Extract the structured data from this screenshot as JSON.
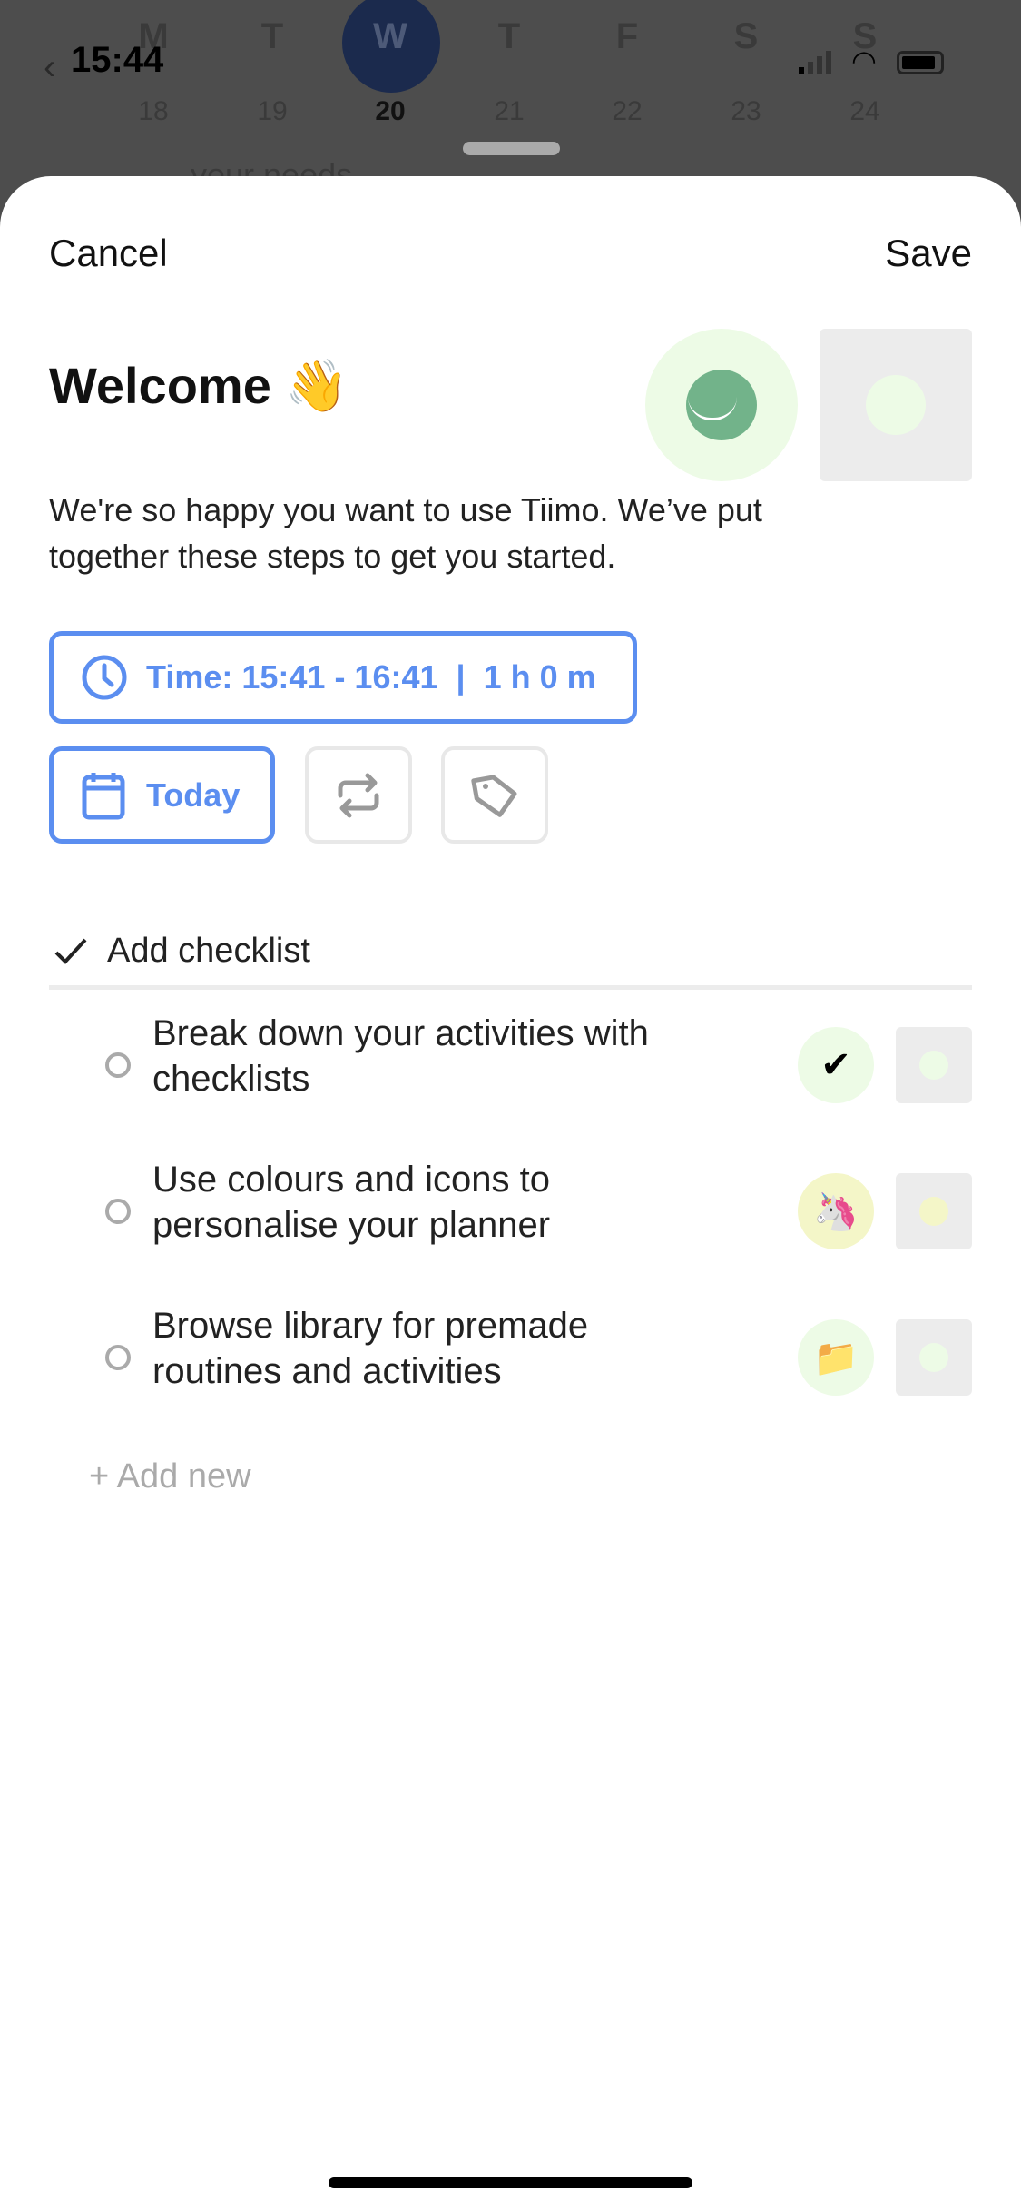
{
  "status": {
    "time": "15:44"
  },
  "week": {
    "days": [
      {
        "l": "M",
        "d": "18"
      },
      {
        "l": "T",
        "d": "19"
      },
      {
        "l": "W",
        "d": "20"
      },
      {
        "l": "T",
        "d": "21"
      },
      {
        "l": "F",
        "d": "22"
      },
      {
        "l": "S",
        "d": "23"
      },
      {
        "l": "S",
        "d": "24"
      }
    ],
    "selected_index": 2
  },
  "background_peek": "your needs",
  "header": {
    "cancel": "Cancel",
    "save": "Save"
  },
  "title": "Welcome 👋",
  "description": "We're so happy you want to use Tiimo. We’ve put together these steps to get you started.",
  "time_button": "Time: 15:41 - 16:41  |  1 h 0 m",
  "date_button": "Today",
  "checklist": {
    "label": "Add checklist",
    "items": [
      {
        "text": "Break down your activities with checklists",
        "icon": "✔",
        "icon_bg": "#edfbe6",
        "dot": "#edfbe6"
      },
      {
        "text": "Use colours and icons to personalise your planner",
        "icon": "🦄",
        "icon_bg": "#f4f6c8",
        "dot": "#f4f6c8"
      },
      {
        "text": "Browse library for premade routines and activities",
        "icon": "📁",
        "icon_bg": "#edfbe6",
        "dot": "#edfbe6"
      }
    ],
    "add_new": "+ Add new"
  },
  "colors": {
    "accent": "#5b8ef0",
    "icon_green": "#72b38a",
    "icon_bg": "#edfbe6"
  }
}
